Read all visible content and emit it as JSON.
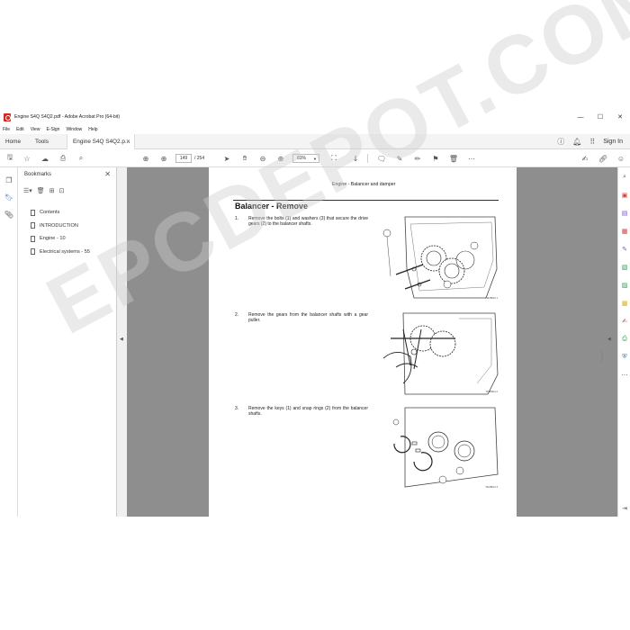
{
  "window": {
    "title": "Engine S4Q S4Q2.pdf - Adobe Acrobat Pro (64-bit)"
  },
  "menubar": {
    "items": [
      "File",
      "Edit",
      "View",
      "E-Sign",
      "Window",
      "Help"
    ]
  },
  "tabs": {
    "home": "Home",
    "tools": "Tools",
    "document": "Engine S4Q S4Q2.p...",
    "sign_in": "Sign In"
  },
  "toolbar": {
    "page_current": "149",
    "page_total": "/ 254",
    "zoom": "83%"
  },
  "bookmarks": {
    "header": "Bookmarks",
    "items": [
      {
        "label": "Contents"
      },
      {
        "label": "INTRODUCTION"
      },
      {
        "label": "Engine - 10"
      },
      {
        "label": "Electrical systems - 55"
      }
    ]
  },
  "page": {
    "running_head": "Engine - Balancer and damper",
    "section_title": "Balancer - Remove",
    "steps": [
      {
        "num": "1.",
        "text": "Remove the bolts (1) and washers (3) that secure the drive gears (2) to the balancer shafts.",
        "fig_caption": "701/89/10   1"
      },
      {
        "num": "2.",
        "text": "Remove the gears from the balancer shafts with a gear puller.",
        "fig_caption": "701/89/11   2"
      },
      {
        "num": "3.",
        "text": "Remove the keys (1) and snap rings (2) from the balancer shafts.",
        "fig_caption": "701/89/12   3"
      }
    ]
  },
  "watermark": "EPCDEPOT.COM",
  "colors": {
    "acrobat_red": "#d7261e",
    "doc_background": "#8e8e8e",
    "page": "#ffffff"
  }
}
